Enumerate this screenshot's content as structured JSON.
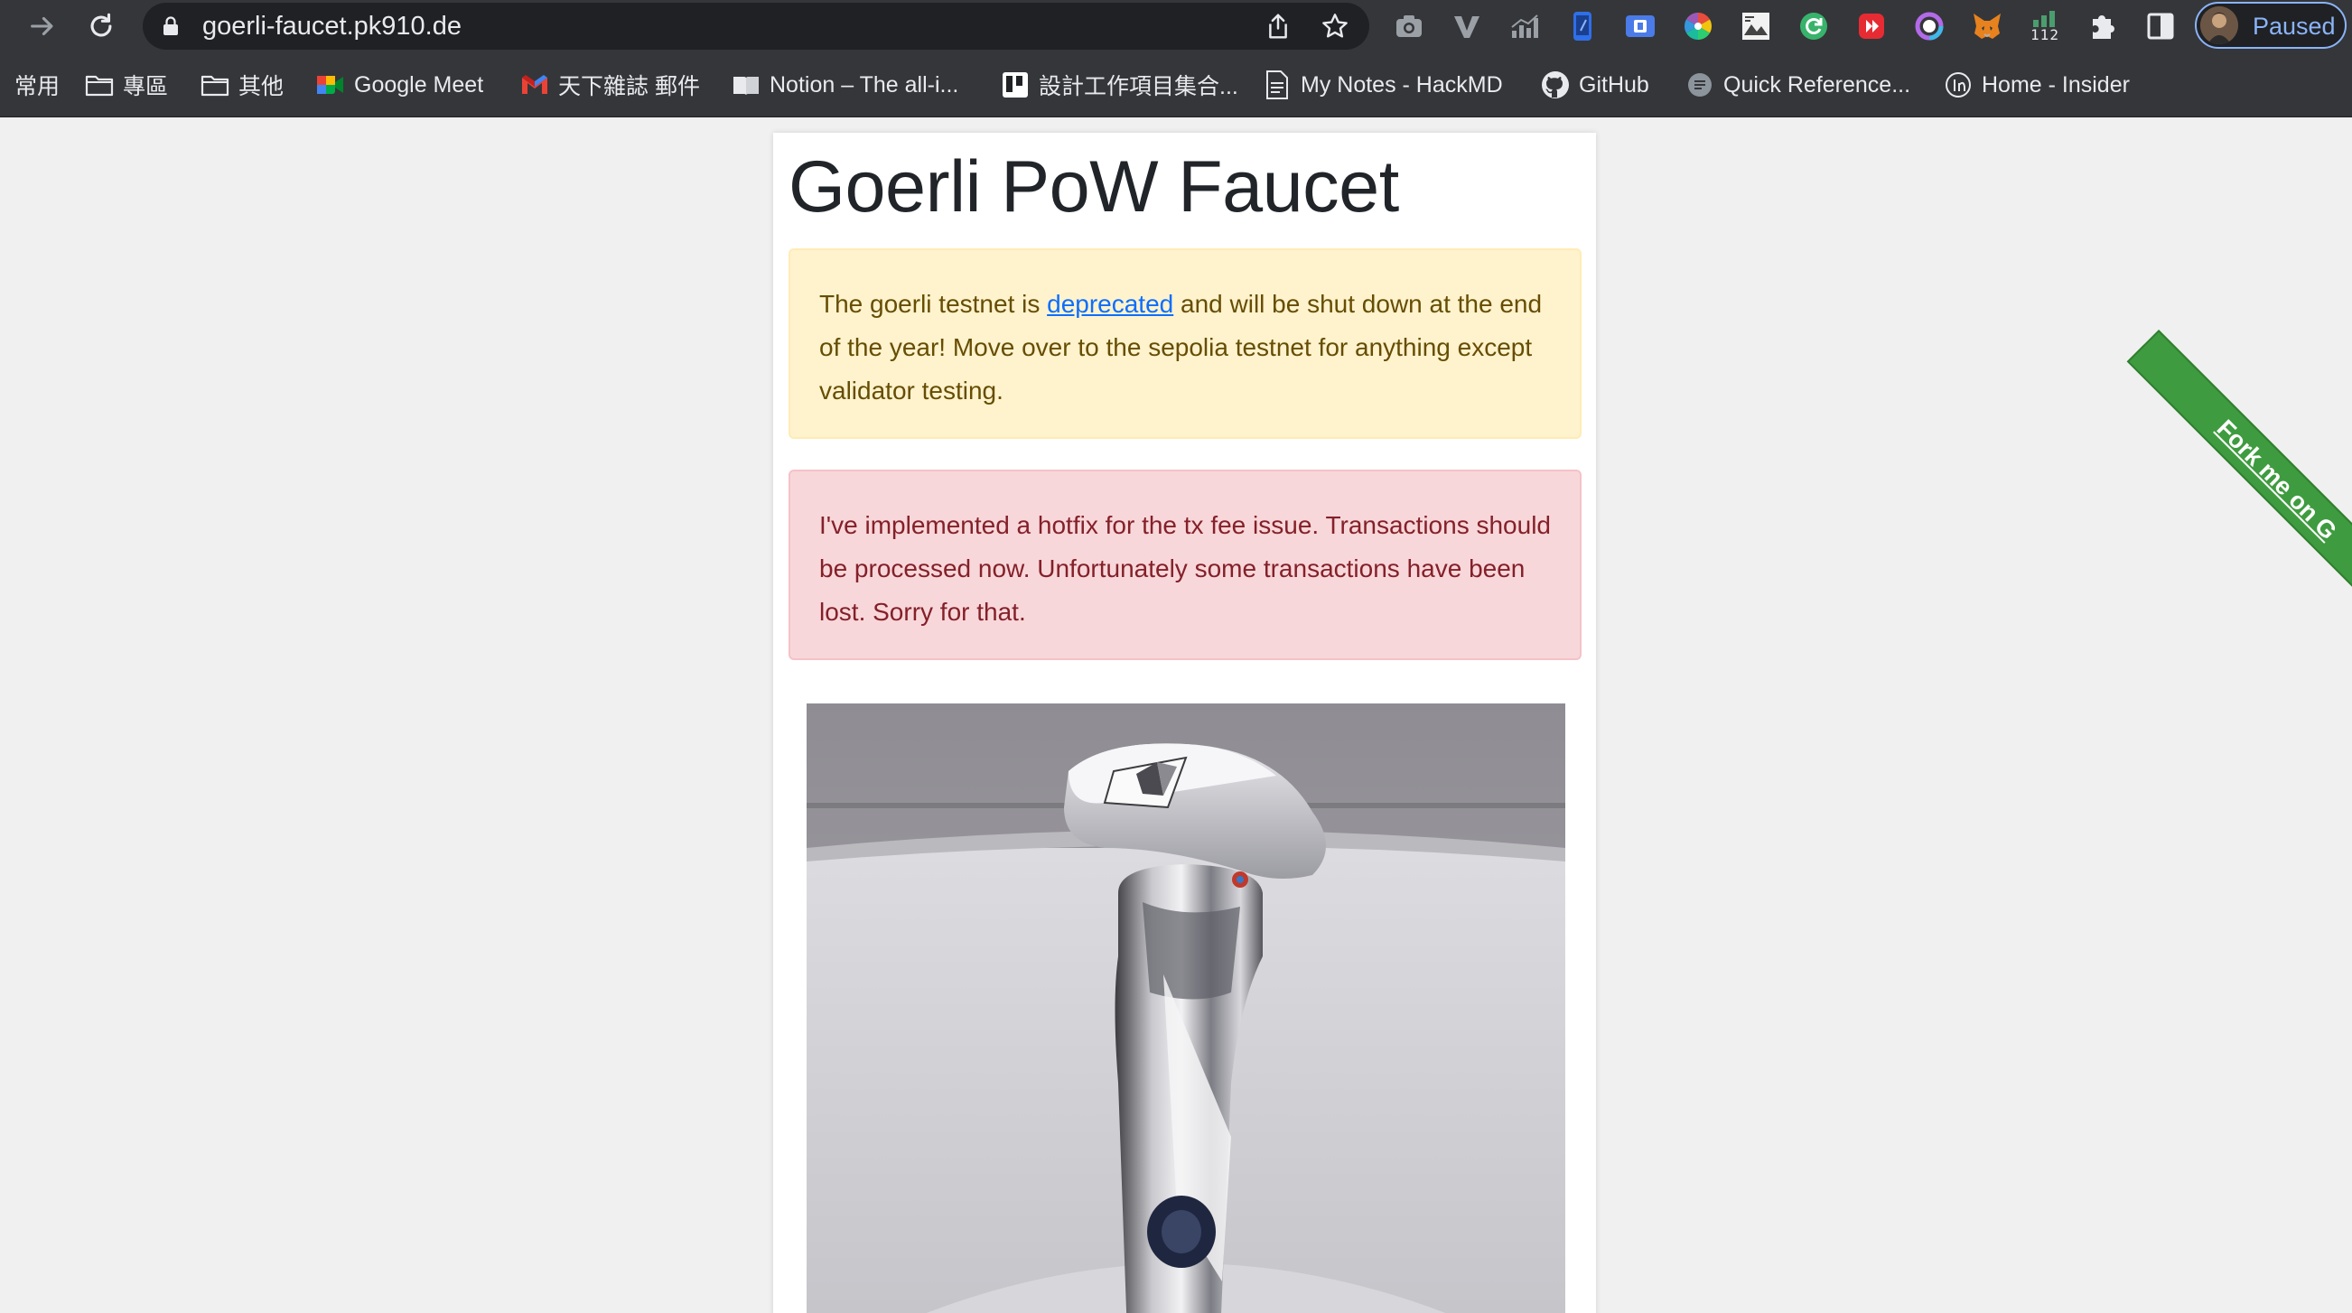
{
  "browser": {
    "url": "goerli-faucet.pk910.de",
    "profile_status": "Paused",
    "extension_badge": "112",
    "extensions": [
      "camera-icon",
      "vimeo-icon",
      "chart-icon",
      "phone-icon",
      "window-icon",
      "color-wheel-icon",
      "image-icon",
      "refresh-green-icon",
      "youtube-red-icon",
      "ring-icon",
      "metamask-fox-icon",
      "stats-icon",
      "puzzle-icon",
      "side-panel-icon"
    ]
  },
  "bookmarks": [
    {
      "label": "常用",
      "icon": "none"
    },
    {
      "label": "專區",
      "icon": "folder-icon"
    },
    {
      "label": "其他",
      "icon": "folder-icon"
    },
    {
      "label": "Google Meet",
      "icon": "meet-icon"
    },
    {
      "label": "天下雜誌 郵件",
      "icon": "gmail-icon"
    },
    {
      "label": "Notion – The all-i...",
      "icon": "book-icon"
    },
    {
      "label": "設計工作項目集合...",
      "icon": "board-icon"
    },
    {
      "label": "My Notes - HackMD",
      "icon": "document-icon"
    },
    {
      "label": "GitHub",
      "icon": "github-icon"
    },
    {
      "label": "Quick Reference...",
      "icon": "reference-icon"
    },
    {
      "label": "Home - Insider",
      "icon": "insider-icon"
    }
  ],
  "page": {
    "title": "Goerli PoW Faucet",
    "warning": {
      "before": "The goerli testnet is ",
      "link": "deprecated",
      "after": " and will be shut down at the end of the year! Move over to the sepolia testnet for anything except validator testing."
    },
    "danger_text": "I've implemented a hotfix for the tx fee issue. Transactions should be processed now. Unfortunately some transactions have been lost. Sorry for that.",
    "image": "faucet-tap-photo",
    "fork_ribbon": "Fork me on G"
  },
  "colors": {
    "warning_bg": "#fff3cd",
    "danger_bg": "#f8d7da",
    "link": "#0d6efd",
    "ribbon": "#3f9b3f",
    "profile_accent": "#8ab4f8"
  }
}
